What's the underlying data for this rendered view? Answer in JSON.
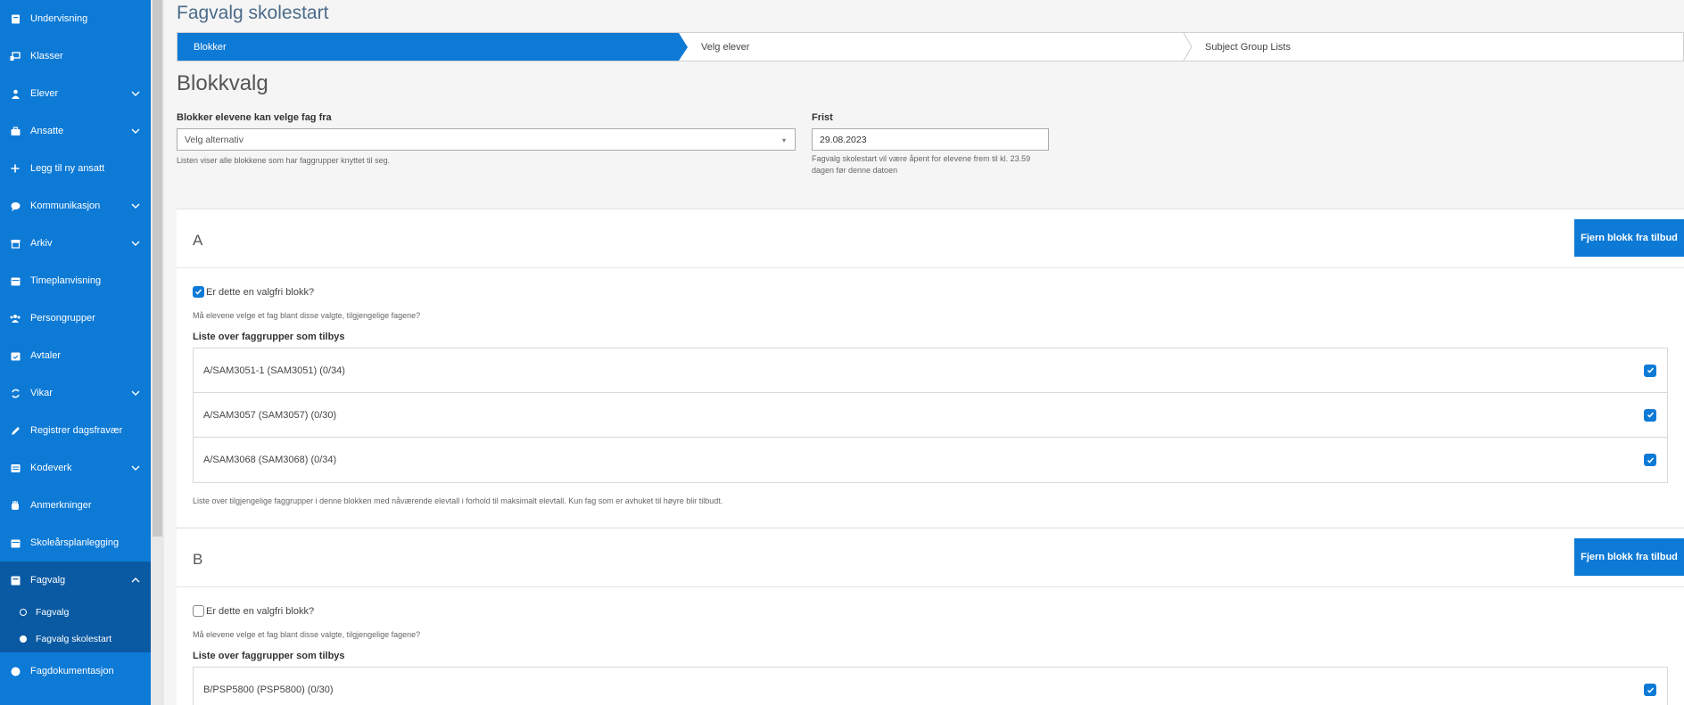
{
  "sidebar": {
    "items": [
      {
        "label": "Undervisning",
        "icon": "book-icon",
        "chevron": false
      },
      {
        "label": "Klasser",
        "icon": "class-icon",
        "chevron": false
      },
      {
        "label": "Elever",
        "icon": "student-icon",
        "chevron": true
      },
      {
        "label": "Ansatte",
        "icon": "briefcase-icon",
        "chevron": true
      },
      {
        "label": "Legg til ny ansatt",
        "icon": "plus-icon",
        "chevron": false
      },
      {
        "label": "Kommunikasjon",
        "icon": "chat-icon",
        "chevron": true
      },
      {
        "label": "Arkiv",
        "icon": "archive-icon",
        "chevron": true
      },
      {
        "label": "Timeplanvisning",
        "icon": "calendar-icon",
        "chevron": false
      },
      {
        "label": "Persongrupper",
        "icon": "group-icon",
        "chevron": false
      },
      {
        "label": "Avtaler",
        "icon": "calendar-check-icon",
        "chevron": false
      },
      {
        "label": "Vikar",
        "icon": "swap-icon",
        "chevron": true
      },
      {
        "label": "Registrer dagsfravær",
        "icon": "pencil-icon",
        "chevron": false
      },
      {
        "label": "Kodeverk",
        "icon": "list-icon",
        "chevron": true
      },
      {
        "label": "Anmerkninger",
        "icon": "hand-icon",
        "chevron": false
      },
      {
        "label": "Skoleårsplanlegging",
        "icon": "calendar-icon",
        "chevron": false
      },
      {
        "label": "Fagvalg",
        "icon": "book-open-icon",
        "chevron": true,
        "expanded": true
      },
      {
        "label": "Fagdokumentasjon",
        "icon": "circle-icon",
        "chevron": false
      }
    ],
    "subitems": [
      {
        "label": "Fagvalg",
        "selected": false
      },
      {
        "label": "Fagvalg skolestart",
        "selected": true
      }
    ]
  },
  "page": {
    "title": "Fagvalg skolestart",
    "steps": [
      "Blokker",
      "Velg elever",
      "Subject Group Lists"
    ],
    "section_title": "Blokkvalg"
  },
  "form": {
    "blocks_label": "Blokker elevene kan velge fag fra",
    "blocks_placeholder": "Velg alternativ",
    "blocks_hint": "Listen viser alle blokkene som har faggrupper knyttet til seg.",
    "deadline_label": "Frist",
    "deadline_value": "29.08.2023",
    "deadline_hint_1": "Fagvalg skolestart vil være åpent for elevene frem til kl. 23.59",
    "deadline_hint_2": "dagen før denne datoen"
  },
  "blocks": [
    {
      "letter": "A",
      "remove_label": "Fjern blokk fra tilbud",
      "elective_label": "Er dette en valgfri blokk?",
      "elective_checked": true,
      "elective_hint": "Må elevene velge et fag blant disse valgte, tilgjengelige fagene?",
      "list_label": "Liste over faggrupper som tilbys",
      "groups": [
        "A/SAM3051-1 (SAM3051) (0/34)",
        "A/SAM3057 (SAM3057) (0/30)",
        "A/SAM3068 (SAM3068) (0/34)"
      ],
      "list_hint": "Liste over tilgjengelige faggrupper i denne blokken med nåværende elevtall i forhold til maksimalt elevtall. Kun fag som er avhuket til høyre blir tilbudt."
    },
    {
      "letter": "B",
      "remove_label": "Fjern blokk fra tilbud",
      "elective_label": "Er dette en valgfri blokk?",
      "elective_checked": false,
      "elective_hint": "Må elevene velge et fag blant disse valgte, tilgjengelige fagene?",
      "list_label": "Liste over faggrupper som tilbys",
      "groups": [
        "B/PSP5800 (PSP5800) (0/30)"
      ]
    }
  ],
  "colors": {
    "accent": "#0d7ad6",
    "sidebar_active": "#0a5aa3"
  }
}
